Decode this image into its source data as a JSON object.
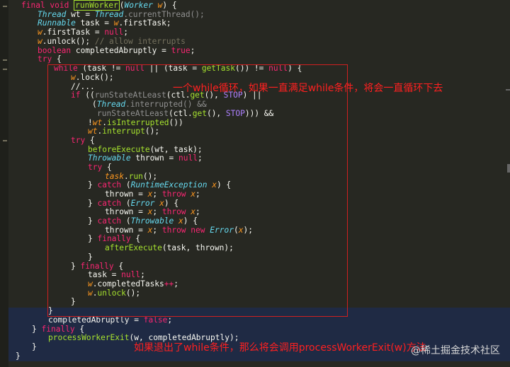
{
  "code": {
    "l0": [
      "final void ",
      "runWorker",
      "(",
      "Worker",
      " ",
      "w",
      ") {"
    ],
    "l1": [
      "Thread",
      " wt = ",
      "Thread",
      ".currentThread();"
    ],
    "l2": [
      "Runnable",
      " task = ",
      "w",
      ".firstTask;"
    ],
    "l3": [
      "w",
      ".firstTask = ",
      "null",
      ";"
    ],
    "l4": [
      "w",
      ".unlock(); ",
      "// allow interrupts"
    ],
    "l5": [
      "boolean",
      " completedAbruptly = ",
      "true",
      ";"
    ],
    "l6": [
      "try",
      " {"
    ],
    "l7": [
      "while",
      " (task != ",
      "null",
      " || (task = ",
      "getTask",
      "()) != ",
      "null",
      ") {"
    ],
    "l8": [
      "w",
      ".lock();"
    ],
    "l9": [
      "//..."
    ],
    "l10": [
      "if",
      " ((",
      "runStateAtLeast",
      "(ctl.",
      "get",
      "(), ",
      "STOP",
      ") ||"
    ],
    "l11": [
      "(",
      "Thread",
      ".interrupted() &&"
    ],
    "l12": [
      "runStateAtLeast",
      "(ctl.",
      "get",
      "(), ",
      "STOP",
      "))) &&"
    ],
    "l13": [
      "!",
      "wt",
      ".",
      "isInterrupted",
      "())"
    ],
    "l14": [
      "wt",
      ".",
      "interrupt",
      "();"
    ],
    "l15": [
      "try",
      " {"
    ],
    "l16": [
      "beforeExecute",
      "(wt, task);"
    ],
    "l17": [
      "Throwable",
      " thrown = ",
      "null",
      ";"
    ],
    "l18": [
      "try",
      " {"
    ],
    "l19": [
      "task",
      ".",
      "run",
      "();"
    ],
    "l20": [
      "} ",
      "catch",
      " (",
      "RuntimeException",
      " ",
      "x",
      ") {"
    ],
    "l21": [
      "thrown = ",
      "x",
      "; ",
      "throw",
      " ",
      "x",
      ";"
    ],
    "l22": [
      "} ",
      "catch",
      " (",
      "Error",
      " ",
      "x",
      ") {"
    ],
    "l23": [
      "thrown = ",
      "x",
      "; ",
      "throw",
      " ",
      "x",
      ";"
    ],
    "l24": [
      "} ",
      "catch",
      " (",
      "Throwable",
      " ",
      "x",
      ") {"
    ],
    "l25": [
      "thrown = ",
      "x",
      "; ",
      "throw",
      " ",
      "new",
      " ",
      "Error",
      "(",
      "x",
      ");"
    ],
    "l26": [
      "} ",
      "finally",
      " {"
    ],
    "l27": [
      "afterExecute",
      "(task, thrown);"
    ],
    "l28": [
      "}"
    ],
    "l29": [
      "} ",
      "finally",
      " {"
    ],
    "l30": [
      "task = ",
      "null",
      ";"
    ],
    "l31": [
      "w",
      ".completedTasks",
      "++",
      ";"
    ],
    "l32": [
      "w",
      ".",
      "unlock",
      "();"
    ],
    "l33": [
      "}"
    ],
    "l34": [
      "}"
    ],
    "l35": [
      "completedAbruptly = ",
      "false",
      ";"
    ],
    "l36": [
      "} ",
      "finally",
      " {"
    ],
    "l37": [
      "processWorkerExit",
      "(w, completedAbruptly);"
    ],
    "l38": [
      "}"
    ],
    "l39": [
      "}"
    ]
  },
  "annotations": {
    "while_note": "一个while循环，如果一直满足while条件，将会一直循环下去",
    "exit_note": "如果退出了while条件，那么将会调用processWorkerExit(w)方法"
  },
  "watermark": "@稀土掘金技术社区",
  "colors": {
    "background": "#272822",
    "keyword": "#f92672",
    "type": "#66d9ef",
    "function": "#a6e22e",
    "annotation": "#ff2020",
    "box": "#d02020"
  }
}
